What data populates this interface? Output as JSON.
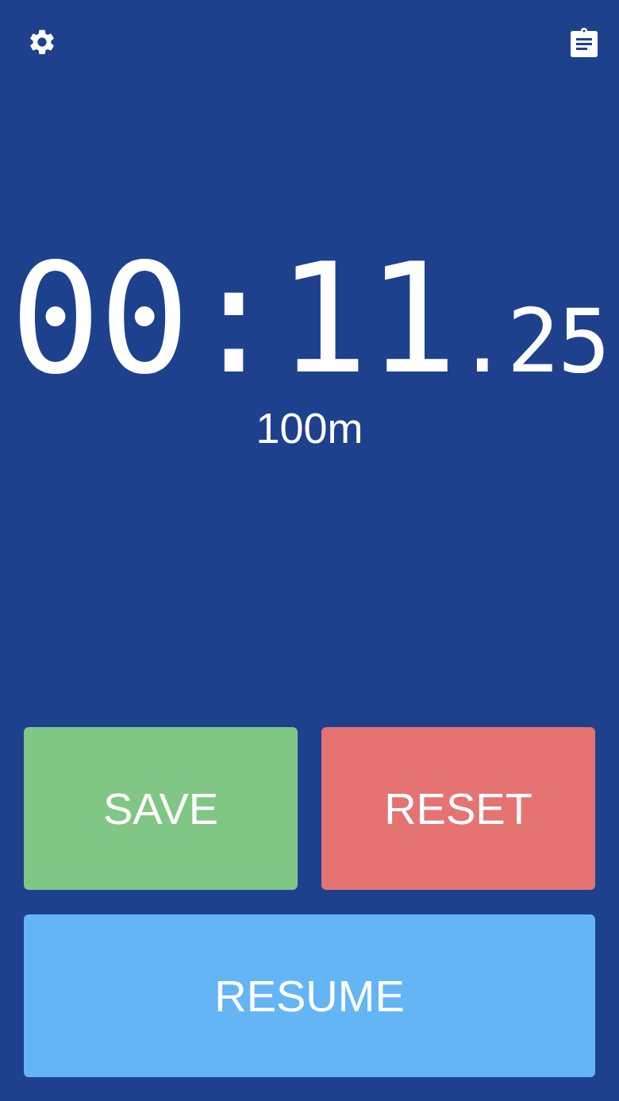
{
  "timer": {
    "main": "00:11",
    "fraction": ".25"
  },
  "distance": "100m",
  "buttons": [
    {
      "label": "SAVE",
      "kind": "save"
    },
    {
      "label": "RESET",
      "kind": "reset"
    },
    {
      "label": "RESUME",
      "kind": "resume"
    }
  ]
}
